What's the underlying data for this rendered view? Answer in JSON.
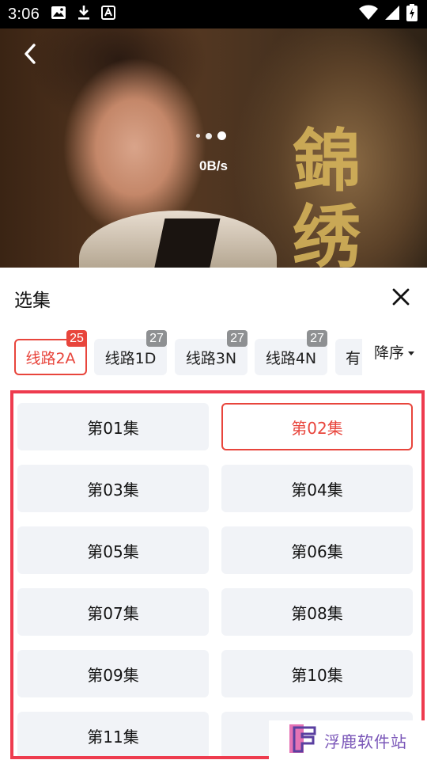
{
  "status_bar": {
    "time": "3:06",
    "left_icons": [
      "image-icon",
      "download-icon",
      "a-notification-icon"
    ],
    "right_icons": [
      "wifi-icon",
      "signal-icon",
      "battery-charging-icon"
    ]
  },
  "player": {
    "speed": "0B/s",
    "back_icon": "chevron-left-icon",
    "poster_text": "錦 绣"
  },
  "panel": {
    "title": "选集",
    "close_icon": "close-icon"
  },
  "routes": [
    {
      "label": "线路2A",
      "badge": "25",
      "active": true
    },
    {
      "label": "线路1D",
      "badge": "27",
      "active": false
    },
    {
      "label": "线路3N",
      "badge": "27",
      "active": false
    },
    {
      "label": "线路4N",
      "badge": "27",
      "active": false
    },
    {
      "label": "有",
      "badge": "",
      "active": false
    }
  ],
  "sort": {
    "label": "降序",
    "icon": "caret-down-icon"
  },
  "episodes": [
    {
      "label": "第01集",
      "active": false
    },
    {
      "label": "第02集",
      "active": true
    },
    {
      "label": "第03集",
      "active": false
    },
    {
      "label": "第04集",
      "active": false
    },
    {
      "label": "第05集",
      "active": false
    },
    {
      "label": "第06集",
      "active": false
    },
    {
      "label": "第07集",
      "active": false
    },
    {
      "label": "第08集",
      "active": false
    },
    {
      "label": "第09集",
      "active": false
    },
    {
      "label": "第10集",
      "active": false
    },
    {
      "label": "第11集",
      "active": false
    }
  ],
  "watermark": {
    "text": "浮鹿软件站"
  },
  "colors": {
    "accent": "#e8453c",
    "badge_gray": "#8e9092",
    "tile_bg": "#f1f3f7",
    "highlight_frame": "#ee3b4e",
    "watermark": "#7a56b8"
  }
}
